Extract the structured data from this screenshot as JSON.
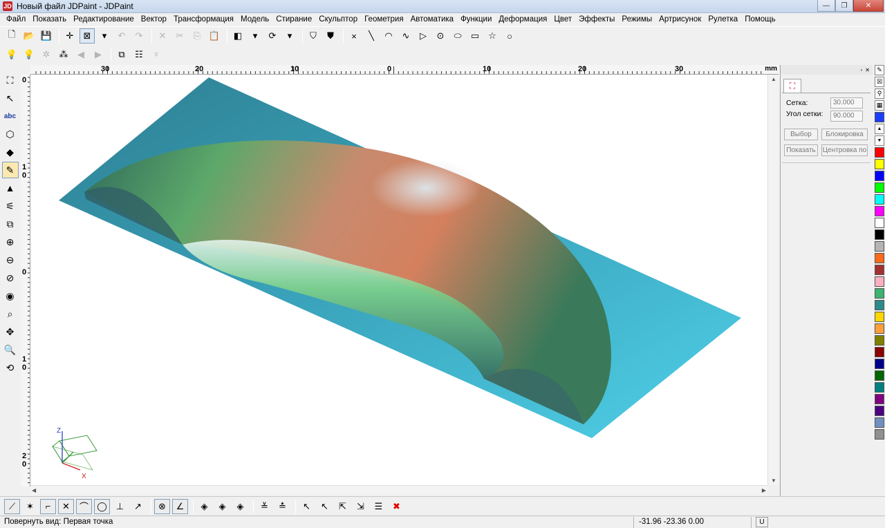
{
  "window": {
    "title": "Новый файл JDPaint - JDPaint",
    "app_icon": "JD",
    "minimize": "—",
    "maximize": "❐",
    "close": "✕"
  },
  "menu": [
    "Файл",
    "Показать",
    "Редактирование",
    "Вектор",
    "Трансформация",
    "Модель",
    "Стирание",
    "Скульптор",
    "Геометрия",
    "Автоматика",
    "Функции",
    "Деформация",
    "Цвет",
    "Эффекты",
    "Режимы",
    "Артрисунок",
    "Рулетка",
    "Помощь"
  ],
  "toolbar1": {
    "buttons": [
      {
        "name": "new-file-icon",
        "glyph": "🗋",
        "state": "normal"
      },
      {
        "name": "open-folder-icon",
        "glyph": "📂",
        "state": "normal"
      },
      {
        "name": "save-icon",
        "glyph": "💾",
        "state": "normal"
      },
      {
        "sep": true
      },
      {
        "name": "crosshair-icon",
        "glyph": "✛",
        "state": "normal"
      },
      {
        "name": "select-box-icon",
        "glyph": "⊠",
        "state": "active"
      },
      {
        "name": "dropdown-arrow-icon",
        "glyph": "▾",
        "state": "normal"
      },
      {
        "name": "undo-icon",
        "glyph": "↶",
        "state": "disabled"
      },
      {
        "name": "redo-icon",
        "glyph": "↷",
        "state": "disabled"
      },
      {
        "sep": true
      },
      {
        "name": "delete-icon",
        "glyph": "✕",
        "state": "disabled"
      },
      {
        "name": "cut-icon",
        "glyph": "✂",
        "state": "disabled"
      },
      {
        "name": "copy-icon",
        "glyph": "⎘",
        "state": "disabled"
      },
      {
        "name": "paste-icon",
        "glyph": "📋",
        "state": "disabled"
      },
      {
        "sep": true
      },
      {
        "name": "layer-icon",
        "glyph": "◧",
        "state": "normal"
      },
      {
        "name": "dropdown-arrow-icon",
        "glyph": "▾",
        "state": "normal"
      },
      {
        "name": "refresh-icon",
        "glyph": "⟳",
        "state": "normal"
      },
      {
        "name": "dropdown-arrow-icon",
        "glyph": "▾",
        "state": "normal"
      },
      {
        "sep": true
      },
      {
        "name": "shield-icon",
        "glyph": "⛉",
        "state": "normal"
      },
      {
        "name": "shield-filled-icon",
        "glyph": "⛊",
        "state": "normal"
      },
      {
        "sep": true
      },
      {
        "name": "point-icon",
        "glyph": "×",
        "state": "normal"
      },
      {
        "name": "line-icon",
        "glyph": "╲",
        "state": "normal"
      },
      {
        "name": "arc-icon",
        "glyph": "◠",
        "state": "normal"
      },
      {
        "name": "curve-icon",
        "glyph": "∿",
        "state": "normal"
      },
      {
        "name": "triangle-icon",
        "glyph": "▷",
        "state": "normal"
      },
      {
        "name": "circle-dot-icon",
        "glyph": "⊙",
        "state": "normal"
      },
      {
        "name": "ellipse-icon",
        "glyph": "⬭",
        "state": "normal"
      },
      {
        "name": "rectangle-icon",
        "glyph": "▭",
        "state": "normal"
      },
      {
        "name": "star-icon",
        "glyph": "☆",
        "state": "normal"
      },
      {
        "name": "circle-icon",
        "glyph": "○",
        "state": "normal"
      }
    ]
  },
  "toolbar2": {
    "buttons": [
      {
        "name": "light-green-icon",
        "glyph": "💡",
        "state": "normal"
      },
      {
        "name": "light-yellow-icon",
        "glyph": "💡",
        "state": "normal"
      },
      {
        "name": "light-settings-icon",
        "glyph": "✲",
        "state": "disabled"
      },
      {
        "name": "lights-group-icon",
        "glyph": "⁂",
        "state": "normal"
      },
      {
        "name": "move-left-icon",
        "glyph": "◀",
        "state": "disabled"
      },
      {
        "name": "move-right-icon",
        "glyph": "▶",
        "state": "disabled"
      },
      {
        "sep": true
      },
      {
        "name": "mirror-icon",
        "glyph": "⧉",
        "state": "normal"
      },
      {
        "name": "grid-lines-icon",
        "glyph": "☷",
        "state": "normal"
      },
      {
        "name": "tree-icon",
        "glyph": "♆",
        "state": "disabled"
      }
    ]
  },
  "left_toolbar": [
    {
      "name": "node-select-icon",
      "glyph": "⛶",
      "active": false
    },
    {
      "name": "vector-edit-icon",
      "glyph": "↖",
      "active": false
    },
    {
      "name": "text-icon",
      "glyph": "abc",
      "active": false
    },
    {
      "name": "offset-shape-icon",
      "glyph": "⬡",
      "active": false
    },
    {
      "name": "fill-color-icon",
      "glyph": "◆",
      "active": false
    },
    {
      "name": "sculpt-brush-icon",
      "glyph": "✎",
      "active": true
    },
    {
      "name": "relief-icon",
      "glyph": "▲",
      "active": false
    },
    {
      "name": "measure-icon",
      "glyph": "⚟",
      "active": false
    },
    {
      "name": "zoom-window-icon",
      "glyph": "⧉",
      "active": false
    },
    {
      "name": "zoom-in-icon",
      "glyph": "⊕",
      "active": false
    },
    {
      "name": "zoom-out-icon",
      "glyph": "⊖",
      "active": false
    },
    {
      "name": "zoom-disabled-icon",
      "glyph": "⊘",
      "active": false
    },
    {
      "name": "view-eye-icon",
      "glyph": "◉",
      "active": false
    },
    {
      "name": "zoom-fit-icon",
      "glyph": "⌕",
      "active": false
    },
    {
      "name": "pan-icon",
      "glyph": "✥",
      "active": false
    },
    {
      "name": "magnifier-icon",
      "glyph": "🔍",
      "active": false
    },
    {
      "name": "rotate-view-icon",
      "glyph": "⟲",
      "active": false
    }
  ],
  "ruler": {
    "top_labels": [
      "30",
      "20",
      "10",
      "0",
      "10",
      "20",
      "30"
    ],
    "unit": "mm",
    "left_labels": [
      "0",
      "1\n0",
      "0",
      "1\n0",
      "2\n0"
    ]
  },
  "axis_gizmo": {
    "z": "Z",
    "x": "X"
  },
  "right_panel": {
    "grid_label": "Сетка:",
    "grid_value": "30.000",
    "angle_label": "Угол сетки:",
    "angle_value": "90.000",
    "btn_select": "Выбор",
    "btn_lock": "Блокировка",
    "btn_show": "Показать",
    "btn_center": "Центровка по"
  },
  "palette": {
    "tools": [
      {
        "name": "pen-tool-icon",
        "glyph": "✎"
      },
      {
        "name": "no-color-icon",
        "glyph": "☒"
      },
      {
        "name": "eyedropper-icon",
        "glyph": "⚲"
      },
      {
        "name": "pattern-icon",
        "glyph": "▦"
      }
    ],
    "current_color": "#1a3cff",
    "colors": [
      "#ff0000",
      "#ffff00",
      "#0000ff",
      "#00ff00",
      "#00ffff",
      "#ff00ff",
      "#ffffff",
      "#000000",
      "#b4b4b4",
      "#ff6a1a",
      "#a43030",
      "#ffb0c0",
      "#3cb371",
      "#2e8b8b",
      "#ffd700",
      "#ff9f3c",
      "#808000",
      "#8b0000",
      "#00008b",
      "#006400",
      "#008080",
      "#800080",
      "#4b0082",
      "#7090c0",
      "#909090"
    ]
  },
  "bottom_toolbar": [
    {
      "name": "draw-line-icon",
      "glyph": "⟋",
      "style": "boxed"
    },
    {
      "name": "snap-node-icon",
      "glyph": "✶",
      "style": "normal"
    },
    {
      "name": "corner-icon",
      "glyph": "⌐",
      "style": "boxed"
    },
    {
      "name": "intersect-icon",
      "glyph": "✕",
      "style": "boxed"
    },
    {
      "name": "tangent-arc-icon",
      "glyph": "⌒",
      "style": "boxed"
    },
    {
      "name": "circle-snap-icon",
      "glyph": "◯",
      "style": "boxed"
    },
    {
      "name": "perpendicular-icon",
      "glyph": "⊥",
      "style": "normal"
    },
    {
      "name": "extend-icon",
      "glyph": "↗",
      "style": "normal"
    },
    {
      "name": "center-snap-icon",
      "glyph": "⊗",
      "style": "boxed"
    },
    {
      "name": "angle-snap-icon",
      "glyph": "∠",
      "style": "boxed"
    },
    {
      "name": "diamond-grid-icon",
      "glyph": "◈",
      "style": "normal"
    },
    {
      "name": "diamond-grid-2-icon",
      "glyph": "◈",
      "style": "normal"
    },
    {
      "name": "diamond-grid-3-icon",
      "glyph": "◈",
      "style": "normal"
    },
    {
      "name": "layer-stack-icon",
      "glyph": "≚",
      "style": "normal"
    },
    {
      "name": "layer-edit-icon",
      "glyph": "≛",
      "style": "normal"
    },
    {
      "name": "pointer-cross-icon",
      "glyph": "↖",
      "style": "normal"
    },
    {
      "name": "pointer-remove-icon",
      "glyph": "↖",
      "style": "normal"
    },
    {
      "name": "transform-icon",
      "glyph": "⇱",
      "style": "normal"
    },
    {
      "name": "transform-2-icon",
      "glyph": "⇲",
      "style": "normal"
    },
    {
      "name": "list-edit-icon",
      "glyph": "☰",
      "style": "normal"
    },
    {
      "name": "cancel-icon",
      "glyph": "✖",
      "style": "red"
    }
  ],
  "status": {
    "message": "Повернуть вид: Первая точка",
    "coords": "-31.96 -23.36 0.00",
    "unit": "U"
  }
}
